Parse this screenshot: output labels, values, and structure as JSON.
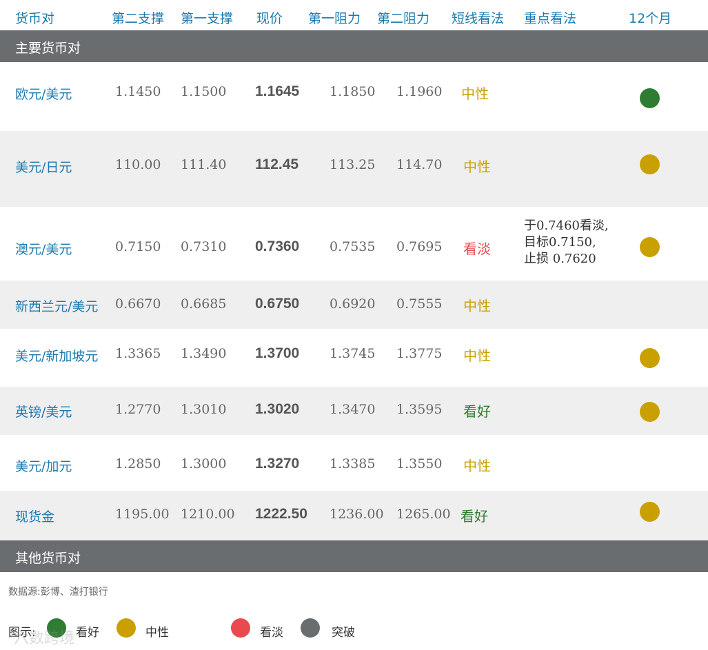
{
  "colors": {
    "bullish": "#2e7d32",
    "neutral": "#c9a000",
    "bearish": "#e84a4f",
    "breakout": "#6a6d70",
    "header_text": "#1a7ab0",
    "section_bar": "#6a6d70"
  },
  "header": {
    "pair": "货币对",
    "support2": "第二支撑",
    "support1": "第一支撑",
    "price": "现价",
    "resist1": "第一阻力",
    "resist2": "第二阻力",
    "short_view": "短线看法",
    "key_view": "重点看法",
    "month12": "12个月"
  },
  "section_main": "主要货币对",
  "rows": [
    {
      "pair": "欧元/美元",
      "s2": "1.1450",
      "s1": "1.1500",
      "price": "1.1645",
      "r1": "1.1850",
      "r2": "1.1960",
      "view": "中性",
      "view_color": "#c9a000",
      "key": "",
      "dot": "#2e7d32"
    },
    {
      "pair": "美元/日元",
      "s2": "110.00",
      "s1": "111.40",
      "price": "112.45",
      "r1": "113.25",
      "r2": "114.70",
      "view": "中性",
      "view_color": "#c9a000",
      "key": "",
      "dot": "#c9a000"
    },
    {
      "pair": "澳元/美元",
      "s2": "0.7150",
      "s1": "0.7310",
      "price": "0.7360",
      "r1": "0.7535",
      "r2": "0.7695",
      "view": "看淡",
      "view_color": "#e84a4f",
      "key": "于0.7460看淡,\n目标0.7150,\n止损 0.7620",
      "dot": "#c9a000"
    },
    {
      "pair": "新西兰元/美元",
      "s2": "0.6670",
      "s1": "0.6685",
      "price": "0.6750",
      "r1": "0.6920",
      "r2": "0.7555",
      "view": "中性",
      "view_color": "#c9a000",
      "key": "",
      "dot": ""
    },
    {
      "pair": "美元/新加坡元",
      "s2": "1.3365",
      "s1": "1.3490",
      "price": "1.3700",
      "r1": "1.3745",
      "r2": "1.3775",
      "view": "中性",
      "view_color": "#c9a000",
      "key": "",
      "dot": "#c9a000"
    },
    {
      "pair": "英镑/美元",
      "s2": "1.2770",
      "s1": "1.3010",
      "price": "1.3020",
      "r1": "1.3470",
      "r2": "1.3595",
      "view": "看好",
      "view_color": "#2e7d32",
      "key": "",
      "dot": "#c9a000"
    },
    {
      "pair": "美元/加元",
      "s2": "1.2850",
      "s1": "1.3000",
      "price": "1.3270",
      "r1": "1.3385",
      "r2": "1.3550",
      "view": "中性",
      "view_color": "#c9a000",
      "key": "",
      "dot": ""
    },
    {
      "pair": "现货金",
      "s2": "1195.00",
      "s1": "1210.00",
      "price": "1222.50",
      "r1": "1236.00",
      "r2": "1265.00",
      "view": "看好",
      "view_color": "#2e7d32",
      "key": "",
      "dot": "#c9a000"
    }
  ],
  "section_other": "其他货币对",
  "source": "数据源:彭博、渣打银行",
  "legend": {
    "title": "图示:",
    "items": [
      {
        "label": "看好",
        "color": "#2e7d32"
      },
      {
        "label": "中性",
        "color": "#c9a000"
      },
      {
        "label": "看淡",
        "color": "#e84a4f"
      },
      {
        "label": "突破",
        "color": "#6a6d70"
      }
    ]
  },
  "watermark": "六数跨境"
}
